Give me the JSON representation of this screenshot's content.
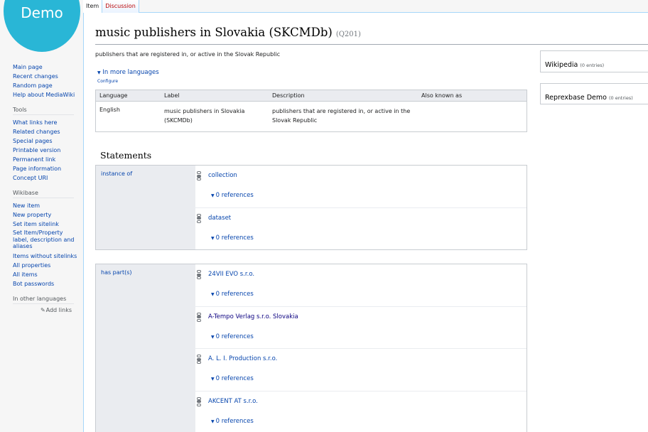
{
  "logo": {
    "text": "Demo"
  },
  "tabs": [
    {
      "label": "Item"
    },
    {
      "label": "Discussion"
    }
  ],
  "sidebar": {
    "navigation": [
      "Main page",
      "Recent changes",
      "Random page",
      "Help about MediaWiki"
    ],
    "tools": {
      "heading": "Tools",
      "items": [
        "What links here",
        "Related changes",
        "Special pages",
        "Printable version",
        "Permanent link",
        "Page information",
        "Concept URI"
      ]
    },
    "wikibase": {
      "heading": "Wikibase",
      "items": [
        "New item",
        "New property",
        "Set item sitelink",
        "Set Item/Property label, description and aliases",
        "Items without sitelinks",
        "All properties",
        "All items",
        "Bot passwords"
      ]
    },
    "languages": {
      "heading": "In other languages",
      "add_links": "Add links"
    }
  },
  "item": {
    "label": "music publishers in Slovakia (SKCMDb)",
    "id": "(Q201)",
    "description": "publishers that are registered in, or active in the Slovak Republic",
    "more_languages": "In more languages",
    "configure": "Configure"
  },
  "lang_table": {
    "headers": [
      "Language",
      "Label",
      "Description",
      "Also known as"
    ],
    "row": {
      "language": "English",
      "label": "music publishers in Slovakia (SKCMDb)",
      "description": "publishers that are registered in, or active in the Slovak Republic",
      "aliases": ""
    }
  },
  "statements": {
    "title": "Statements",
    "groups": [
      {
        "property": "instance of",
        "values": [
          {
            "value": "collection",
            "references": "0 references"
          },
          {
            "value": "dataset",
            "references": "0 references"
          }
        ]
      },
      {
        "property": "has part(s)",
        "values": [
          {
            "value": "24VII EVO s.r.o.",
            "references": "0 references"
          },
          {
            "value": "A-Tempo Verlag s.r.o. Slovakia",
            "references": "0 references"
          },
          {
            "value": "A. L. I. Production s.r.o.",
            "references": "0 references"
          },
          {
            "value": "AKCENT AT s.r.o.",
            "references": "0 references"
          }
        ]
      }
    ]
  },
  "sitelinks": [
    {
      "name": "Wikipedia",
      "count": "(0 entries)"
    },
    {
      "name": "Reprexbase Demo",
      "count": "(0 entries)"
    }
  ]
}
